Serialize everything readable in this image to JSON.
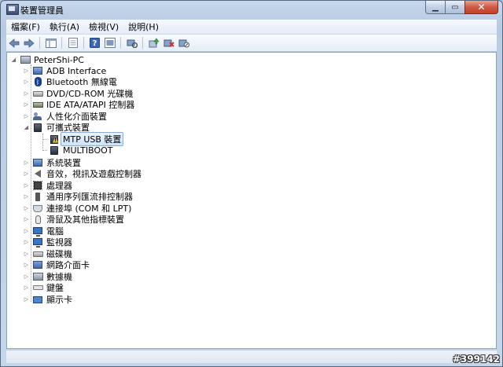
{
  "window": {
    "title": "裝置管理員",
    "icon": "device-manager-icon",
    "caption_buttons": [
      "minimize",
      "maximize",
      "close"
    ]
  },
  "menu": {
    "items": [
      "檔案(F)",
      "執行(A)",
      "檢視(V)",
      "說明(H)"
    ]
  },
  "toolbar": {
    "buttons": [
      "back",
      "forward",
      "show-hide-console-tree",
      "properties-sheet",
      "help",
      "show-hidden",
      "scan-hardware-changes",
      "update-driver",
      "uninstall",
      "disable"
    ]
  },
  "tree": {
    "root": "PeterShi-PC",
    "items": [
      {
        "label": "ADB Interface",
        "icon": "adb-interface-icon",
        "expanded": false
      },
      {
        "label": "Bluetooth 無線電",
        "icon": "bluetooth-icon",
        "expanded": false
      },
      {
        "label": "DVD/CD-ROM 光碟機",
        "icon": "dvd-drive-icon",
        "expanded": false
      },
      {
        "label": "IDE ATA/ATAPI 控制器",
        "icon": "ide-controller-icon",
        "expanded": false
      },
      {
        "label": "人性化介面裝置",
        "icon": "hid-icon",
        "expanded": false
      },
      {
        "label": "可攜式裝置",
        "icon": "portable-device-icon",
        "expanded": true,
        "children": [
          {
            "label": "MTP USB 裝置",
            "icon": "mtp-warning-icon",
            "selected": true
          },
          {
            "label": "MULTIBOOT",
            "icon": "multiboot-device-icon",
            "selected": false
          }
        ]
      },
      {
        "label": "系統裝置",
        "icon": "system-device-icon",
        "expanded": false
      },
      {
        "label": "音效，視訊及遊戲控制器",
        "icon": "speaker-icon",
        "expanded": false
      },
      {
        "label": "處理器",
        "icon": "processor-icon",
        "expanded": false
      },
      {
        "label": "通用序列匯流排控制器",
        "icon": "usb-plug-icon",
        "expanded": false
      },
      {
        "label": "連接埠 (COM 和 LPT)",
        "icon": "port-icon",
        "expanded": false
      },
      {
        "label": "滑鼠及其他指標裝置",
        "icon": "mouse-icon",
        "expanded": false
      },
      {
        "label": "電腦",
        "icon": "computer-icon",
        "expanded": false
      },
      {
        "label": "監視器",
        "icon": "monitor-icon",
        "expanded": false
      },
      {
        "label": "磁碟機",
        "icon": "disk-drive-icon",
        "expanded": false
      },
      {
        "label": "網路介面卡",
        "icon": "network-adapter-icon",
        "expanded": false
      },
      {
        "label": "數據機",
        "icon": "modem-icon",
        "expanded": false
      },
      {
        "label": "鍵盤",
        "icon": "keyboard-icon",
        "expanded": false
      },
      {
        "label": "顯示卡",
        "icon": "display-adapter-icon",
        "expanded": false
      }
    ]
  },
  "watermark": "#399142"
}
